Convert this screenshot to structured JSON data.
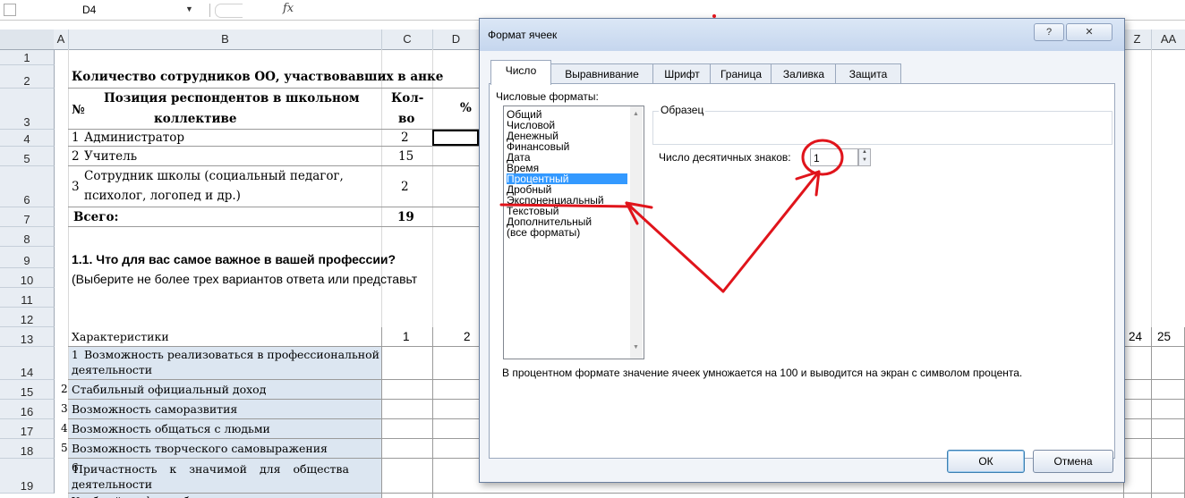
{
  "formula_bar": {
    "name_box": "D4",
    "fx_label": "fx",
    "formula": ""
  },
  "columns": [
    "A",
    "B",
    "C",
    "D",
    "Z",
    "AA"
  ],
  "rows": [
    "1",
    "2",
    "3",
    "4",
    "5",
    "6",
    "7",
    "8",
    "9",
    "10",
    "11",
    "12",
    "13",
    "14",
    "15",
    "16",
    "17",
    "18",
    "19"
  ],
  "sheet": {
    "title": "Количество сотрудников ОО, участвовавших в анке",
    "header_no": "№",
    "header_position_1": "Позиция респондентов в школьном",
    "header_position_2": "коллективе",
    "header_count_1": "Кол-",
    "header_count_2": "во",
    "header_pct": "%",
    "r4_no": "1",
    "r4_name": "Администратор",
    "r4_count": "2",
    "r5_no": "2",
    "r5_name": "Учитель",
    "r5_count": "15",
    "r6_no": "3",
    "r6_name_1": "Сотрудник школы (социальный педагог,",
    "r6_name_2": "психолог, логопед и др.)",
    "r6_count": "2",
    "r7_label": "Всего:",
    "r7_count": "19",
    "q_title": "1.1. Что для вас самое важное в вашей профессии?",
    "q_note": "(Выберите не более трех вариантов ответа или представьт",
    "r13_label": "Характеристики",
    "r13_c1": "1",
    "r13_c2": "2",
    "r13_c24": "24",
    "r13_c25": "25",
    "items": [
      {
        "no": "1",
        "line1": "Возможность реализоваться в профессиональной",
        "line2": "деятельности"
      },
      {
        "no": "2",
        "line1": "Стабильный официальный доход",
        "line2": ""
      },
      {
        "no": "3",
        "line1": "Возможность саморазвития",
        "line2": ""
      },
      {
        "no": "4",
        "line1": "Возможность общаться с людьми",
        "line2": ""
      },
      {
        "no": "5",
        "line1": "Возможность творческого самовыражения",
        "line2": ""
      },
      {
        "no": "6",
        "line1": "Причастность к значимой для общества",
        "line2": "деятельности"
      }
    ],
    "r20_partial": "Удобный график работы"
  },
  "dialog": {
    "title": "Формат ячеек",
    "help": "?",
    "close": "✕",
    "tabs": [
      "Число",
      "Выравнивание",
      "Шрифт",
      "Граница",
      "Заливка",
      "Защита"
    ],
    "active_tab": 0,
    "formats_label": "Числовые форматы:",
    "formats": [
      "Общий",
      "Числовой",
      "Денежный",
      "Финансовый",
      "Дата",
      "Время",
      "Процентный",
      "Дробный",
      "Экспоненциальный",
      "Текстовый",
      "Дополнительный",
      "(все форматы)"
    ],
    "selected_format": 6,
    "sample_label": "Образец",
    "decimals_label": "Число десятичных знаков:",
    "decimals_value": "1",
    "description": "В процентном формате значение ячеек умножается на 100 и выводится на экран с символом процента.",
    "ok": "ОК",
    "cancel": "Отмена"
  },
  "colors": {
    "selection": "#3399ff",
    "annotation": "#e0141b",
    "header_bg": "#e8edf3",
    "label_bg": "#dce6f1"
  }
}
